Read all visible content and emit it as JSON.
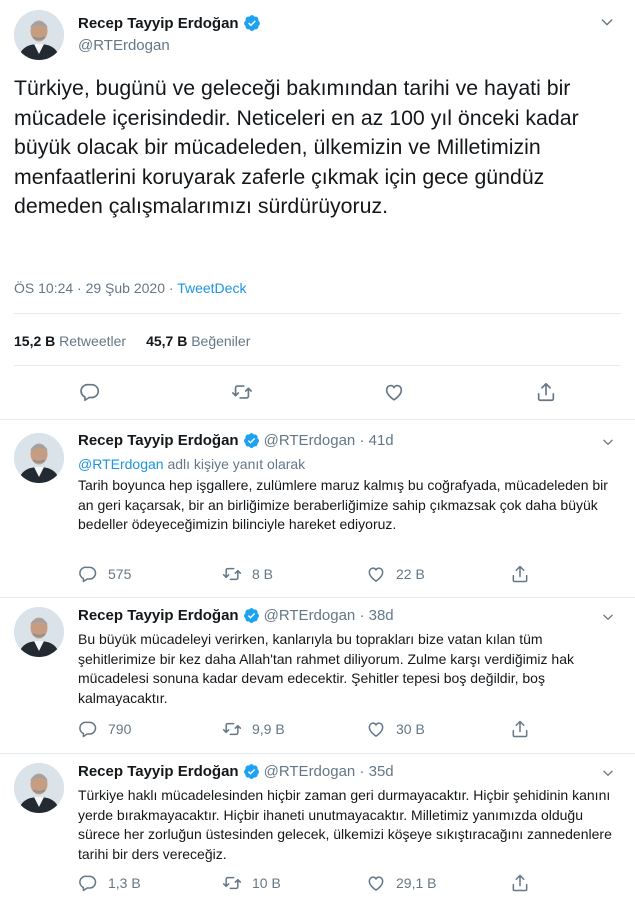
{
  "main_tweet": {
    "author_name": "Recep Tayyip Erdoğan",
    "handle": "@RTErdogan",
    "text": "Türkiye, bugünü ve geleceği bakımından tarihi ve hayati bir mücadele içerisindedir. Neticeleri en az 100 yıl önceki kadar büyük olacak bir mücadeleden, ülkemizin ve Milletimizin menfaatlerini koruyarak zaferle çıkmak için gece gündüz demeden çalışmalarımızı sürdürüyoruz.",
    "time": "ÖS 10:24 · 29 Şub 2020",
    "separator": " · ",
    "source": "TweetDeck",
    "retweets_count": "15,2 B",
    "retweets_label": "Retweetler",
    "likes_count": "45,7 B",
    "likes_label": "Beğeniler"
  },
  "replies": [
    {
      "author_name": "Recep Tayyip Erdoğan",
      "handle_age": "@RTErdogan · 41d",
      "reply_to_link": "@RTErdogan",
      "reply_to_suffix": " adlı kişiye yanıt olarak",
      "text": "Tarih boyunca hep işgallere, zulümlere maruz kalmış bu coğrafyada, mücadeleden bir an geri kaçarsak, bir an birliğimize beraberliğimize sahip çıkmazsak çok daha büyük bedeller ödeyeceğimizin bilinciyle hareket ediyoruz.",
      "replies_count": "575",
      "retweets_count": "8 B",
      "likes_count": "22 B"
    },
    {
      "author_name": "Recep Tayyip Erdoğan",
      "handle_age": "@RTErdogan · 38d",
      "text": "Bu büyük mücadeleyi verirken, kanlarıyla bu toprakları bize vatan kılan tüm şehitlerimize bir kez daha Allah'tan rahmet diliyorum. Zulme karşı verdiğimiz hak mücadelesi sonuna kadar devam edecektir. Şehitler tepesi boş değildir, boş kalmayacaktır.",
      "replies_count": "790",
      "retweets_count": "9,9 B",
      "likes_count": "30 B"
    },
    {
      "author_name": "Recep Tayyip Erdoğan",
      "handle_age": "@RTErdogan · 35d",
      "text": "Türkiye haklı mücadelesinden hiçbir zaman geri durmayacaktır. Hiçbir şehidinin kanını yerde bırakmayacaktır. Hiçbir ihaneti unutmayacaktır. Milletimiz yanımızda olduğu sürece her zorluğun üstesinden gelecek, ülkemizi köşeye sıkıştıracağını zannedenlere tarihi bir ders vereceğiz.",
      "replies_count": "1,3 B",
      "retweets_count": "10 B",
      "likes_count": "29,1 B"
    }
  ],
  "icons": {
    "verified": "verified-badge-icon",
    "reply": "comment-bubble-icon",
    "retweet": "retweet-arrows-icon",
    "like": "heart-icon",
    "share": "share-upload-icon",
    "more": "chevron-down-icon"
  },
  "colors": {
    "accent": "#1b95e0",
    "verified": "#1da1f2",
    "secondary_text": "#657786",
    "border": "#e6ecf0"
  }
}
